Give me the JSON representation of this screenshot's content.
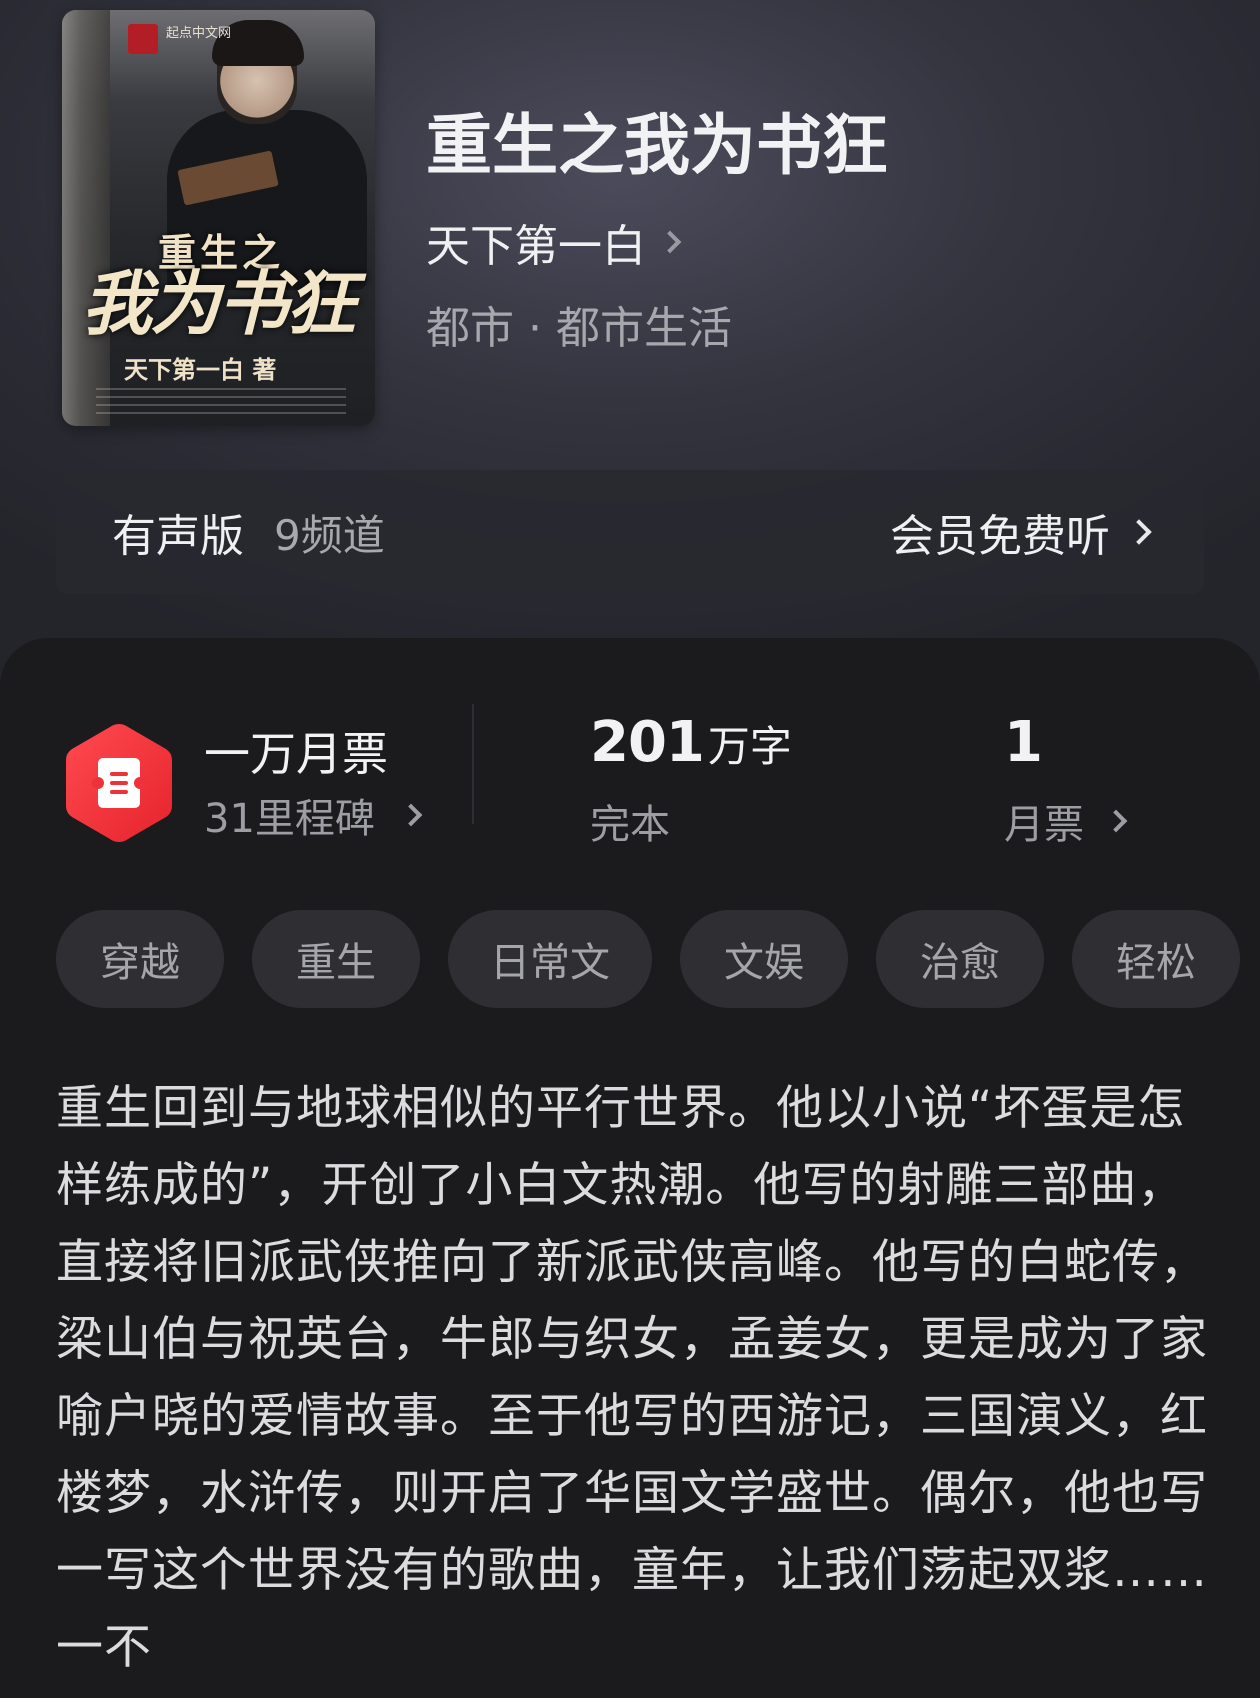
{
  "book": {
    "title": "重生之我为书狂",
    "author": "天下第一白",
    "category": "都市 · 都市生活",
    "cover": {
      "publisher": "起点中文网",
      "title_small": "重生之",
      "title_large": "我为书狂",
      "author_credit": "天下第一白 著"
    }
  },
  "audio": {
    "label": "有声版",
    "channel": "9频道",
    "action": "会员免费听"
  },
  "stats": {
    "ticket_title": "一万月票",
    "ticket_sub": "31里程碑",
    "words_num": "201",
    "words_unit": "万字",
    "status": "完本",
    "votes": "1",
    "votes_label": "月票"
  },
  "tags": [
    "穿越",
    "重生",
    "日常文",
    "文娱",
    "治愈",
    "轻松"
  ],
  "synopsis": "重生回到与地球相似的平行世界。他以小说“坏蛋是怎样练成的”，开创了小白文热潮。他写的射雕三部曲，直接将旧派武侠推向了新派武侠高峰。他写的白蛇传，梁山伯与祝英台，牛郎与织女，孟姜女，更是成为了家喻户晓的爱情故事。至于他写的西游记，三国演义，红楼梦，水浒传，则开启了华国文学盛世。偶尔，他也写一写这个世界没有的歌曲，童年，让我们荡起双浆……一不",
  "colors": {
    "badge_red": "#f2323c",
    "panel_bg": "#1b1b1d",
    "tag_bg": "#2f2f33"
  }
}
